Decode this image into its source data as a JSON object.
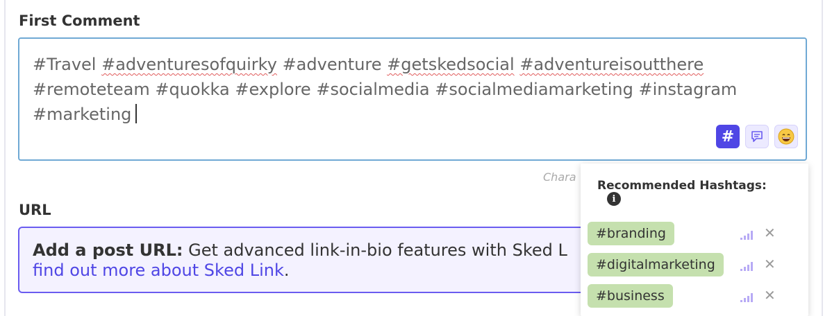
{
  "first_comment": {
    "label": "First Comment",
    "tags": [
      "#Travel",
      "#adventuresofquirky",
      "#adventure",
      "#getskedsocial",
      "#adventureisoutthere",
      "#remoteteam",
      "#quokka",
      "#explore",
      "#socialmedia",
      "#socialmediamarketing",
      "#instagram",
      "#marketing"
    ],
    "char_counter_text": "Chara"
  },
  "toolbar": {
    "hashtag_icon": "hashtag-icon",
    "comment_icon": "speech-bubble-icon",
    "emoji_icon": "grinning-face-icon"
  },
  "url": {
    "label": "URL",
    "prompt_bold": "Add a post URL:",
    "prompt_text": " Get advanced link-in-bio features with Sked L",
    "link_text": "find out more about Sked Link",
    "after_link": "."
  },
  "hashtag_panel": {
    "title": "Recommended Hashtags:",
    "info_icon": "info-icon",
    "items": [
      {
        "tag": "#branding"
      },
      {
        "tag": "#digitalmarketing"
      },
      {
        "tag": "#business"
      }
    ]
  },
  "colors": {
    "accent": "#4f46e5",
    "chip_green": "#c5e0ae",
    "comment_border": "#6fa9d4",
    "url_border": "#6a5cf0"
  }
}
